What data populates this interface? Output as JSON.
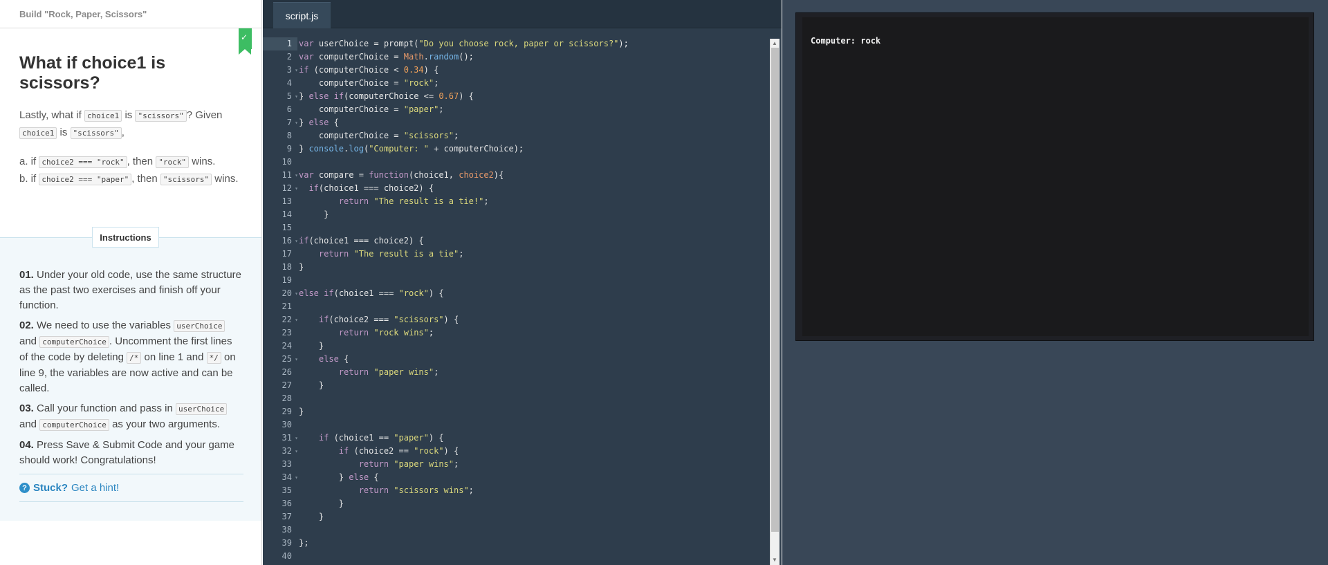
{
  "course": {
    "title": "Build \"Rock, Paper, Scissors\""
  },
  "lesson": {
    "title": "What if choice1 is scissors?",
    "intro": {
      "t1": "Lastly, what if ",
      "c1": "choice1",
      "t2": " is ",
      "c2": "\"scissors\"",
      "t3": "? Given ",
      "c3": "choice1",
      "t4": " is ",
      "c4": "\"scissors\"",
      "t5": ","
    },
    "item_a": {
      "t1": "a. if ",
      "c1": "choice2 === \"rock\"",
      "t2": ", then ",
      "c2": "\"rock\"",
      "t3": " wins."
    },
    "item_b": {
      "t1": "b. if ",
      "c1": "choice2 === \"paper\"",
      "t2": ", then ",
      "c2": "\"scissors\"",
      "t3": " wins."
    }
  },
  "instructions": {
    "tab_label": "Instructions",
    "steps": [
      {
        "num": "01.",
        "t1": " Under your old code, use the same structure as the past two exercises and finish off your function."
      },
      {
        "num": "02.",
        "t1": " We need to use the variables ",
        "c1": "userChoice",
        "t2": " and ",
        "c2": "computerChoice",
        "t3": ". Uncomment the first lines of the code by deleting ",
        "c3": "/*",
        "t4": " on line 1 and ",
        "c4": "*/",
        "t5": " on line 9, the variables are now active and can be called."
      },
      {
        "num": "03.",
        "t1": " Call your function and pass in ",
        "c1": "userChoice",
        "t2": " and ",
        "c2": "computerChoice",
        "t3": " as your two arguments."
      },
      {
        "num": "04.",
        "t1": " Press Save & Submit Code and your game should work! Congratulations!"
      }
    ],
    "hint": {
      "stuck": "Stuck?",
      "link": "Get a hint!"
    }
  },
  "editor": {
    "tab": "script.js",
    "active_line": 1,
    "line_numbers": [
      "1",
      "2",
      "3",
      "4",
      "5",
      "6",
      "7",
      "8",
      "9",
      "10",
      "11",
      "12",
      "13",
      "14",
      "15",
      "16",
      "17",
      "18",
      "19",
      "20",
      "21",
      "22",
      "23",
      "24",
      "25",
      "26",
      "27",
      "28",
      "29",
      "30",
      "31",
      "32",
      "33",
      "34",
      "35",
      "36",
      "37",
      "38",
      "39",
      "40"
    ],
    "lines": [
      "var userChoice = prompt(\"Do you choose rock, paper or scissors?\");",
      "var computerChoice = Math.random();",
      "if (computerChoice < 0.34) {",
      "    computerChoice = \"rock\";",
      "} else if(computerChoice <= 0.67) {",
      "    computerChoice = \"paper\";",
      "} else {",
      "    computerChoice = \"scissors\";",
      "} console.log(\"Computer: \" + computerChoice);",
      "",
      "var compare = function(choice1, choice2){",
      "  if(choice1 === choice2) {",
      "        return \"The result is a tie!\";",
      "     }",
      "",
      "if(choice1 === choice2) {",
      "    return \"The result is a tie\";",
      "}",
      "",
      "else if(choice1 === \"rock\") {",
      "",
      "    if(choice2 === \"scissors\") {",
      "        return \"rock wins\";",
      "    }",
      "    else {",
      "        return \"paper wins\";",
      "    }",
      "",
      "}",
      "",
      "    if (choice1 == \"paper\") {",
      "        if (choice2 == \"rock\") {",
      "            return \"paper wins\";",
      "        } else {",
      "            return \"scissors wins\";",
      "        }",
      "    }",
      "",
      "};",
      ""
    ]
  },
  "output": {
    "console_text": "Computer: rock"
  }
}
